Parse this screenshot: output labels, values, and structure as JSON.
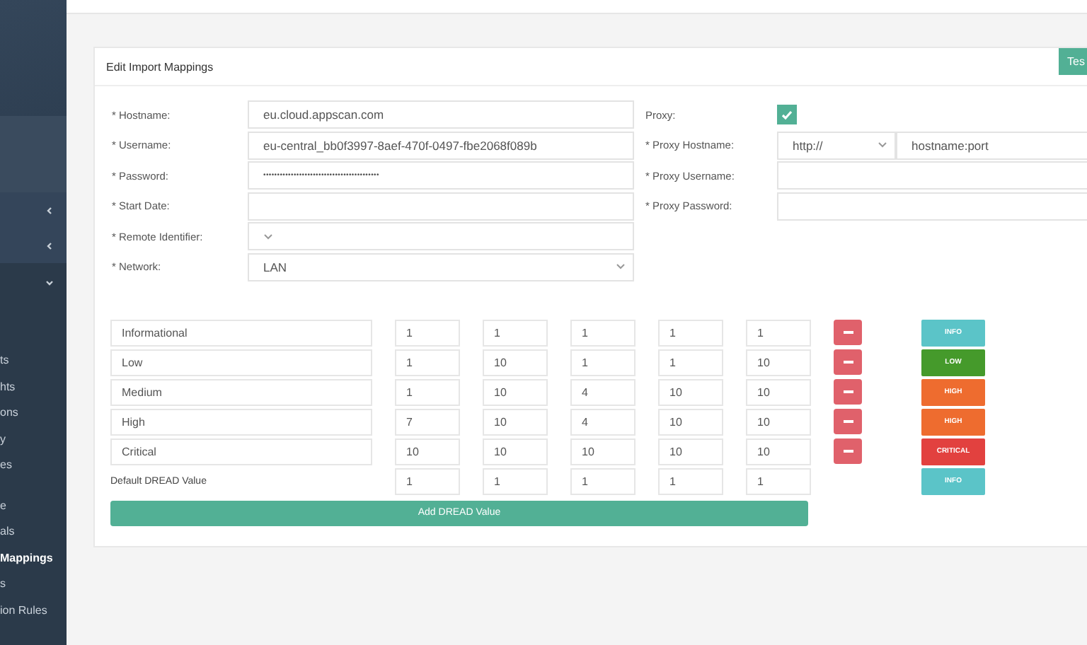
{
  "sidebar": {
    "menus": [
      {
        "expanded": false
      },
      {
        "expanded": false
      },
      {
        "expanded": true
      }
    ],
    "items": [
      {
        "label": "ts",
        "selected": false
      },
      {
        "label": "hts",
        "selected": false
      },
      {
        "label": "ons",
        "selected": false
      },
      {
        "label": "y",
        "selected": false
      },
      {
        "label": "es",
        "selected": false
      },
      {
        "label": "e",
        "selected": false
      },
      {
        "label": "als",
        "selected": false
      },
      {
        "label": "Mappings",
        "selected": true
      },
      {
        "label": "s",
        "selected": false
      },
      {
        "label": "ion Rules",
        "selected": false
      }
    ]
  },
  "card": {
    "title": "Edit Import Mappings",
    "test_button": "Tes"
  },
  "left_fields": [
    {
      "label": "* Hostname:",
      "kind": "text",
      "value": "eu.cloud.appscan.com"
    },
    {
      "label": "* Username:",
      "kind": "text",
      "value": "eu-central_bb0f3997-8aef-470f-0497-fbe2068f089b"
    },
    {
      "label": "* Password:",
      "kind": "password",
      "value": "••••••••••••••••••••••••••••••••••••••••••"
    },
    {
      "label": "* Start Date:",
      "kind": "text"
    },
    {
      "label": "* Remote Identifier:",
      "kind": "select"
    },
    {
      "label": "* Network:",
      "kind": "select",
      "value": "LAN"
    }
  ],
  "proxy": {
    "label": "Proxy:",
    "checked": true
  },
  "proxy_fields": [
    {
      "label": "* Proxy Hostname:",
      "kind": "scheme_host",
      "scheme": "http://",
      "value": "hostname:port"
    },
    {
      "label": "* Proxy Username:",
      "kind": "text"
    },
    {
      "label": "* Proxy Password:",
      "kind": "text"
    }
  ],
  "dread_rows": [
    {
      "name": "Informational",
      "values": [
        "1",
        "1",
        "1",
        "1",
        "1"
      ],
      "badge": {
        "label": "INFO",
        "color": "#5bc4c8"
      }
    },
    {
      "name": "Low",
      "values": [
        "1",
        "10",
        "1",
        "1",
        "10"
      ],
      "badge": {
        "label": "LOW",
        "color": "#459a2b"
      }
    },
    {
      "name": "Medium",
      "values": [
        "1",
        "10",
        "4",
        "10",
        "10"
      ],
      "badge": {
        "label": "HIGH",
        "color": "#ee6c2f"
      }
    },
    {
      "name": "High",
      "values": [
        "7",
        "10",
        "4",
        "10",
        "10"
      ],
      "badge": {
        "label": "HIGH",
        "color": "#ee6c2f"
      }
    },
    {
      "name": "Critical",
      "values": [
        "10",
        "10",
        "10",
        "10",
        "10"
      ],
      "badge": {
        "label": "CRITICAL",
        "color": "#e2413f"
      }
    }
  ],
  "default_row": {
    "label": "Default DREAD Value",
    "values": [
      "1",
      "1",
      "1",
      "1",
      "1"
    ],
    "badge": {
      "label": "INFO",
      "color": "#5bc4c8"
    }
  },
  "add_button": "Add DREAD Value"
}
